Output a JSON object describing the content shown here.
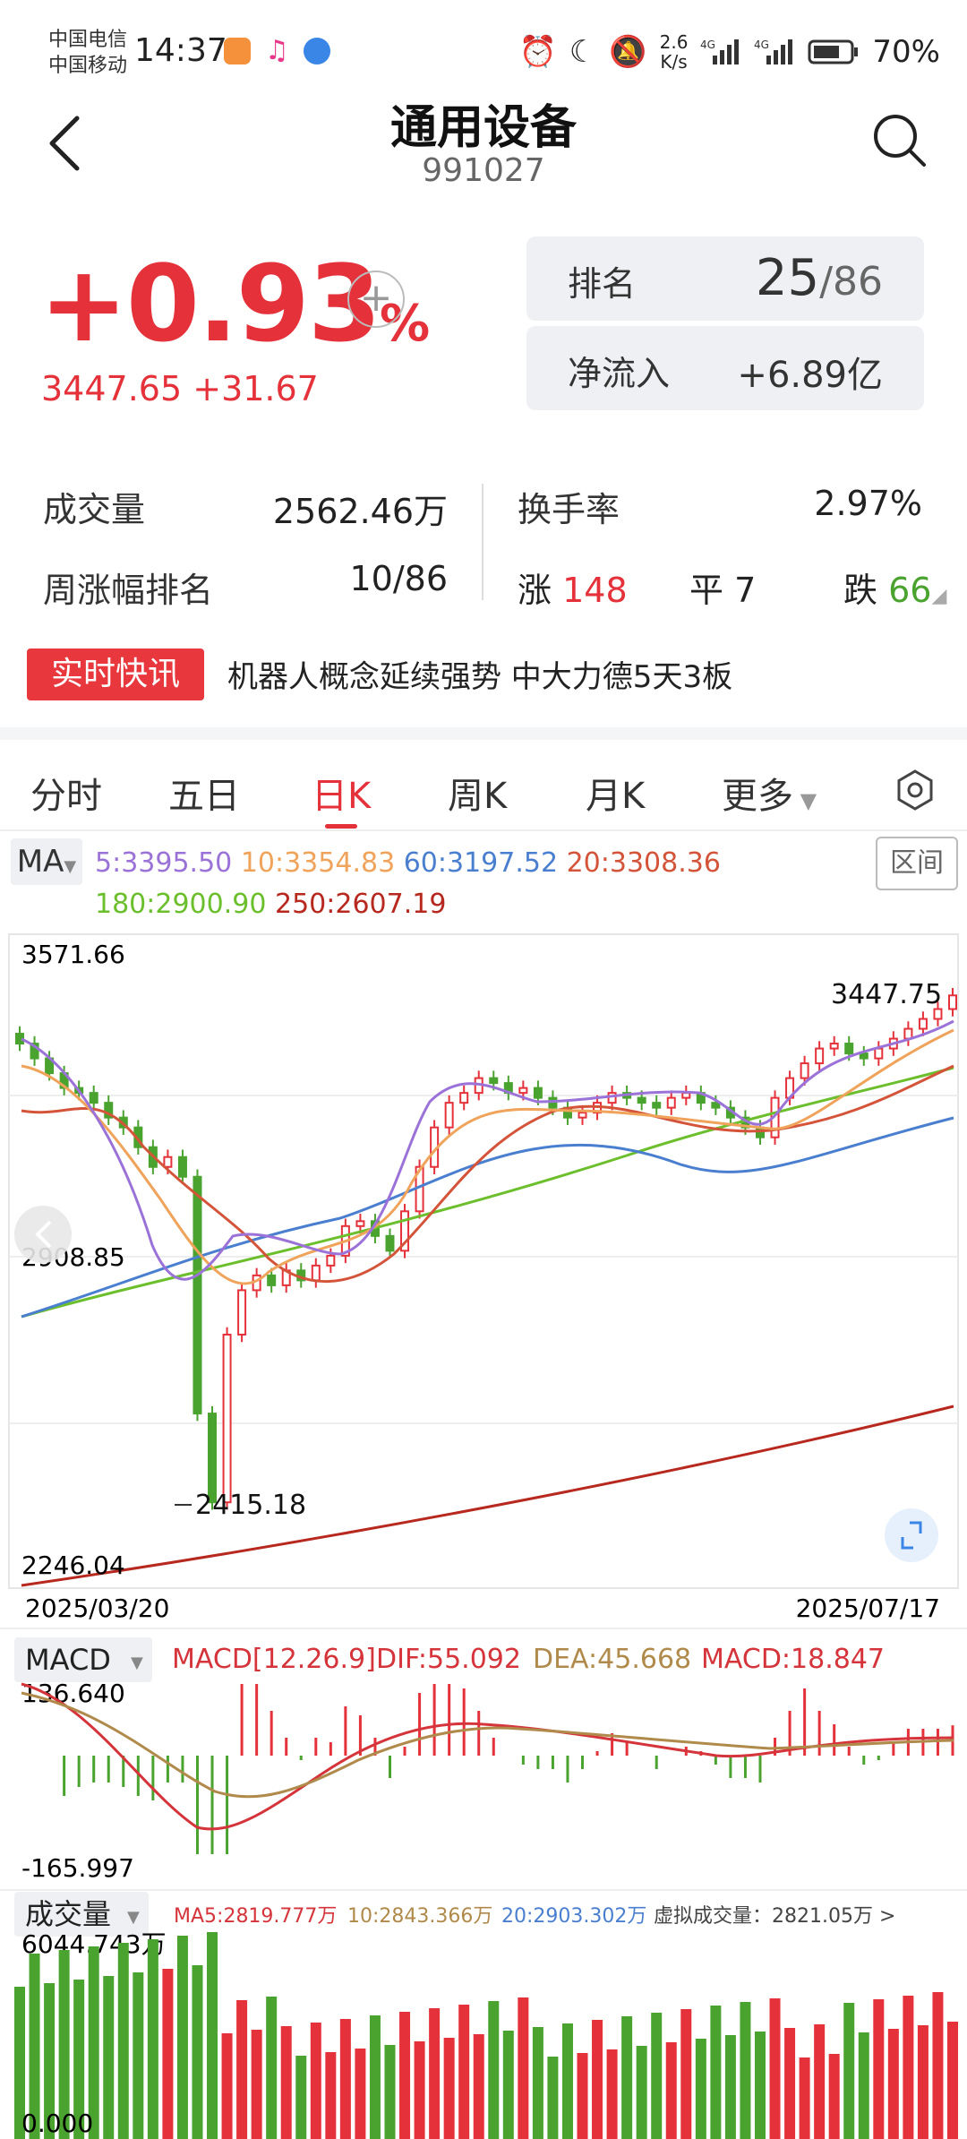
{
  "status_bar": {
    "carrier1": "中国电信",
    "carrier2": "中国移动",
    "time": "14:37",
    "net_speed_value": "2.6",
    "net_speed_unit": "K/s",
    "battery": "70%"
  },
  "header": {
    "title": "通用设备",
    "code": "991027"
  },
  "quote": {
    "change_pct": "+0.93",
    "pct_sign": "%",
    "price": "3447.65",
    "change": "+31.67",
    "add_label": "+"
  },
  "cards": {
    "rank_label": "排名",
    "rank_value": "25",
    "rank_total": "/86",
    "inflow_label": "净流入",
    "inflow_value": "+6.89亿"
  },
  "stats": {
    "volume_label": "成交量",
    "volume_value": "2562.46万",
    "turnover_label": "换手率",
    "turnover_value": "2.97%",
    "week_rank_label": "周涨幅排名",
    "week_rank_value": "10/86",
    "up_label": "涨",
    "up_value": "148",
    "flat_label": "平",
    "flat_value": "7",
    "down_label": "跌",
    "down_value": "66"
  },
  "flash": {
    "tag": "实时快讯",
    "text": "机器人概念延续强势 中大力德5天3板"
  },
  "tabs": [
    "分时",
    "五日",
    "日K",
    "周K",
    "月K",
    "更多"
  ],
  "ma_legend": {
    "button": "MA",
    "ma5": "5:3395.50",
    "ma10": "10:3354.83",
    "ma60": "60:3197.52",
    "ma20": "20:3308.36",
    "ma180": "180:2900.90",
    "ma250": "250:2607.19",
    "range_btn": "区间"
  },
  "chart_data": {
    "type": "candlestick",
    "y_top_label": "3571.66",
    "y_mid_label": "2908.85",
    "y_bottom_label": "2246.04",
    "ylim": [
      2246.04,
      3571.66
    ],
    "high_marker": "3447.75",
    "low_marker": "2415.18",
    "x_start": "2025/03/20",
    "x_end": "2025/07/17",
    "approx_closes": [
      3350,
      3320,
      3290,
      3260,
      3250,
      3230,
      3200,
      3180,
      3140,
      3100,
      3120,
      3080,
      2600,
      2420,
      2760,
      2850,
      2880,
      2860,
      2890,
      2870,
      2900,
      2920,
      2980,
      2990,
      2960,
      2930,
      3010,
      3100,
      3180,
      3230,
      3250,
      3280,
      3270,
      3250,
      3260,
      3240,
      3220,
      3200,
      3210,
      3230,
      3250,
      3240,
      3230,
      3220,
      3240,
      3250,
      3230,
      3220,
      3200,
      3180,
      3160,
      3240,
      3280,
      3310,
      3340,
      3350,
      3330,
      3320,
      3340,
      3360,
      3380,
      3400,
      3420,
      3447.65
    ]
  },
  "macd": {
    "label": "MACD",
    "params": "MACD[12.26.9]",
    "dif": "DIF:55.092",
    "dea": "DEA:45.668",
    "macd": "MACD:18.847",
    "top": "136.640",
    "bottom": "-165.997"
  },
  "volume_panel": {
    "label": "成交量",
    "ma5": "MA5:2819.777万",
    "ma10": "10:2843.366万",
    "ma20": "20:2903.302万",
    "virtual": "虚拟成交量：2821.05万 >",
    "top": "6044.743万",
    "bottom": "0.000"
  },
  "colors": {
    "up": "#e5313a",
    "down": "#4aa32f",
    "ma5": "#9b73d8",
    "ma10": "#f0a35a",
    "ma20": "#d4543a",
    "ma60": "#4a7fd0",
    "ma180": "#6cbf2c",
    "ma250": "#b7281f"
  }
}
